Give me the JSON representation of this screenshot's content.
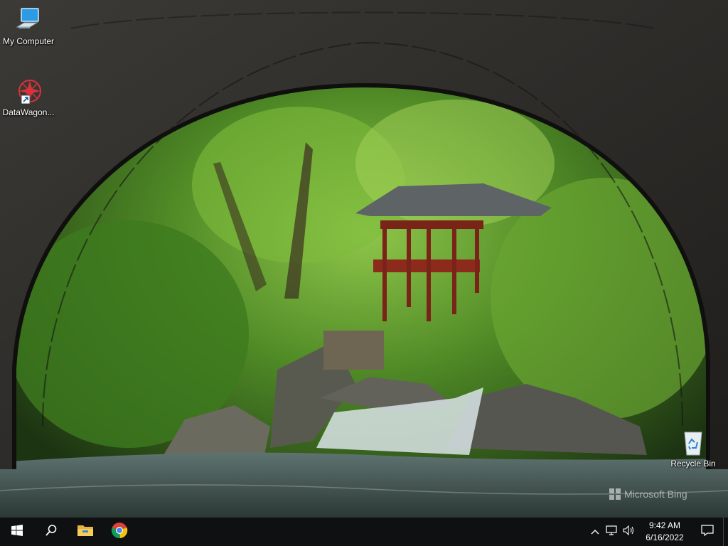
{
  "desktop": {
    "wallpaper_watermark": "Microsoft Bing",
    "icons": [
      {
        "label": "My Computer",
        "icon": "computer-icon"
      },
      {
        "label": "DataWagon...",
        "icon": "datawagon-shortcut-icon"
      },
      {
        "label": "Recycle Bin",
        "icon": "recycle-bin-icon"
      }
    ]
  },
  "taskbar": {
    "start_icon": "windows-start-icon",
    "search_icon": "search-icon",
    "pinned": [
      "file-explorer-icon",
      "chrome-icon"
    ],
    "tray_icons": [
      "chevron-up-icon",
      "network-icon",
      "volume-icon"
    ],
    "clock": {
      "time": "9:42 AM",
      "date": "6/16/2022"
    },
    "notification_icon": "action-center-icon"
  }
}
